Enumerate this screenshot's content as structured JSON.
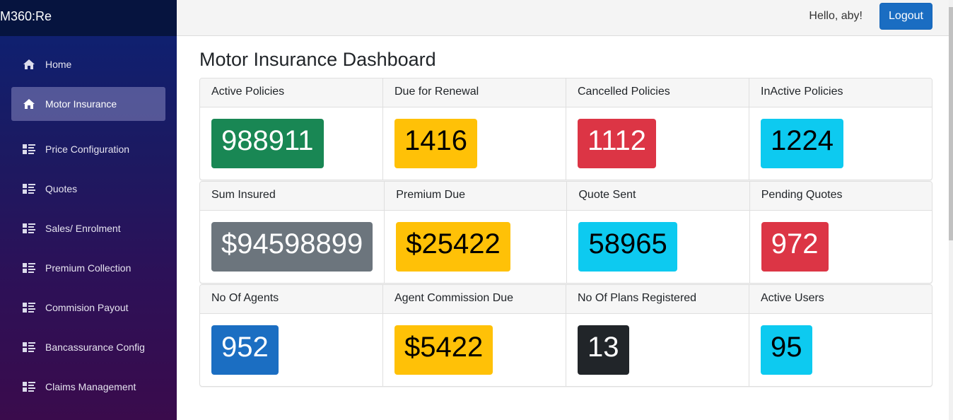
{
  "brand": "M360:Re",
  "sidebar": {
    "items": [
      {
        "label": "Home",
        "icon": "home-icon",
        "active": false
      },
      {
        "label": "Motor Insurance",
        "icon": "home-icon",
        "active": true
      },
      {
        "label": "Price Configuration",
        "icon": "list-icon",
        "active": false
      },
      {
        "label": "Quotes",
        "icon": "list-icon",
        "active": false
      },
      {
        "label": "Sales/ Enrolment",
        "icon": "list-icon",
        "active": false
      },
      {
        "label": "Premium Collection",
        "icon": "list-icon",
        "active": false
      },
      {
        "label": "Commision Payout",
        "icon": "list-icon",
        "active": false
      },
      {
        "label": "Bancassurance Config",
        "icon": "list-icon",
        "active": false
      },
      {
        "label": "Claims Management",
        "icon": "list-icon",
        "active": false
      }
    ]
  },
  "header": {
    "greeting": "Hello, aby!",
    "logout_label": "Logout"
  },
  "main": {
    "title": "Motor Insurance Dashboard",
    "rows": [
      [
        {
          "label": "Active Policies",
          "value": "988911",
          "color": "#198754",
          "variant": "success"
        },
        {
          "label": "Due for Renewal",
          "value": "1416",
          "color": "#ffc107",
          "variant": "warning"
        },
        {
          "label": "Cancelled Policies",
          "value": "1112",
          "color": "#dc3545",
          "variant": "danger"
        },
        {
          "label": "InActive Policies",
          "value": "1224",
          "color": "#0dcaf0",
          "variant": "info"
        }
      ],
      [
        {
          "label": "Sum Insured",
          "value": "$94598899",
          "color": "#6c757d",
          "variant": "secondary"
        },
        {
          "label": "Premium Due",
          "value": "$25422",
          "color": "#ffc107",
          "variant": "warning"
        },
        {
          "label": "Quote Sent",
          "value": "58965",
          "color": "#0dcaf0",
          "variant": "info"
        },
        {
          "label": "Pending Quotes",
          "value": "972",
          "color": "#dc3545",
          "variant": "danger"
        }
      ],
      [
        {
          "label": "No Of Agents",
          "value": "952",
          "color": "#1b6ec2",
          "variant": "primary"
        },
        {
          "label": "Agent Commission Due",
          "value": "$5422",
          "color": "#ffc107",
          "variant": "warning"
        },
        {
          "label": "No Of Plans Registered",
          "value": "13",
          "color": "#212529",
          "variant": "dark"
        },
        {
          "label": "Active Users",
          "value": "95",
          "color": "#0dcaf0",
          "variant": "info"
        }
      ]
    ]
  }
}
